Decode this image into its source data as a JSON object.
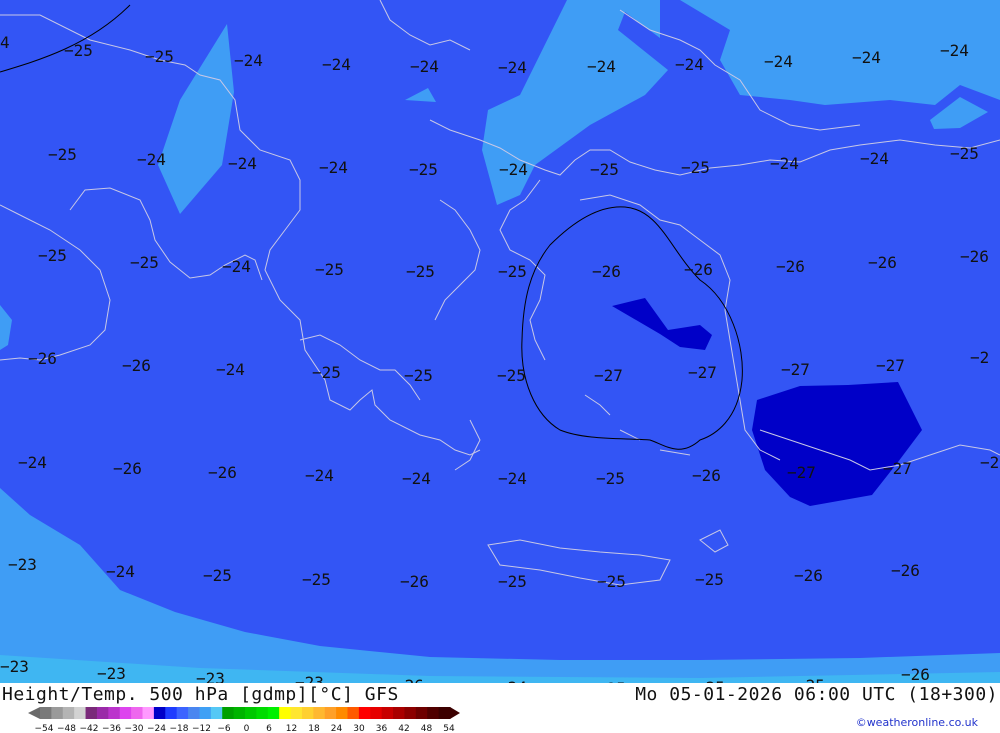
{
  "map": {
    "colors": {
      "deep_blue": "#0000c8",
      "mid_blue": "#3355f5",
      "light_blue": "#3f9df5",
      "coast_line": "#c8c8e6",
      "contour_line": "#000000"
    },
    "labels": [
      {
        "t": "4"
      },
      {
        "t": "-25"
      },
      {
        "t": "-25"
      },
      {
        "t": "-24"
      },
      {
        "t": "-24"
      },
      {
        "t": "-24"
      },
      {
        "t": "-24"
      },
      {
        "t": "-24"
      },
      {
        "t": "-24"
      },
      {
        "t": "-24"
      },
      {
        "t": "-24"
      },
      {
        "t": "-24"
      },
      {
        "t": "-25"
      },
      {
        "t": "-24"
      },
      {
        "t": "-24"
      },
      {
        "t": "-24"
      },
      {
        "t": "-25"
      },
      {
        "t": "-24"
      },
      {
        "t": "-25"
      },
      {
        "t": "-25"
      },
      {
        "t": "-24"
      },
      {
        "t": "-24"
      },
      {
        "t": "-25"
      },
      {
        "t": "-25"
      },
      {
        "t": "-25"
      },
      {
        "t": "-24"
      },
      {
        "t": "-25"
      },
      {
        "t": "-25"
      },
      {
        "t": "-25"
      },
      {
        "t": "-26"
      },
      {
        "t": "-26"
      },
      {
        "t": "-26"
      },
      {
        "t": "-26"
      },
      {
        "t": "-26"
      },
      {
        "t": "-26"
      },
      {
        "t": "-26"
      },
      {
        "t": "-24"
      },
      {
        "t": "-25"
      },
      {
        "t": "-25"
      },
      {
        "t": "-25"
      },
      {
        "t": "-27"
      },
      {
        "t": "-27"
      },
      {
        "t": "-27"
      },
      {
        "t": "-27"
      },
      {
        "t": "-2"
      },
      {
        "t": "-24"
      },
      {
        "t": "-26"
      },
      {
        "t": "-26"
      },
      {
        "t": "-24"
      },
      {
        "t": "-24"
      },
      {
        "t": "-24"
      },
      {
        "t": "-25"
      },
      {
        "t": "-26"
      },
      {
        "t": "-27"
      },
      {
        "t": "-27"
      },
      {
        "t": "-2"
      },
      {
        "t": "-23"
      },
      {
        "t": "-24"
      },
      {
        "t": "-25"
      },
      {
        "t": "-25"
      },
      {
        "t": "-26"
      },
      {
        "t": "-25"
      },
      {
        "t": "-25"
      },
      {
        "t": "-25"
      },
      {
        "t": "-26"
      },
      {
        "t": "-26"
      },
      {
        "t": "-23"
      },
      {
        "t": "-23"
      },
      {
        "t": "-23"
      },
      {
        "t": "-23"
      },
      {
        "t": "-26"
      },
      {
        "t": "-24"
      },
      {
        "t": "-25"
      },
      {
        "t": "-25"
      },
      {
        "t": "-25"
      },
      {
        "t": "-26"
      }
    ]
  },
  "footer": {
    "title": "Height/Temp. 500 hPa [gdmp][°C] GFS",
    "datetime": "Mo 05-01-2026 06:00 UTC (18+300)",
    "credit": "©weatheronline.co.uk"
  },
  "colorbar": {
    "ticks": [
      "-54",
      "-48",
      "-42",
      "-36",
      "-30",
      "-24",
      "-18",
      "-12",
      "-6",
      "0",
      "6",
      "12",
      "18",
      "24",
      "30",
      "36",
      "42",
      "48",
      "54"
    ],
    "swatches": [
      "#7a7a7a",
      "#9a9a9a",
      "#b4b4b4",
      "#d2d2d2",
      "#7a2a7a",
      "#9a2aa8",
      "#bb33cc",
      "#dd44ee",
      "#ee66ee",
      "#ff99ff",
      "#0000c8",
      "#1e3cff",
      "#3c64ff",
      "#4a86f0",
      "#3fa0f5",
      "#55c8f5",
      "#00a000",
      "#00b400",
      "#00c800",
      "#00dc00",
      "#00f000",
      "#ffff00",
      "#ffe630",
      "#ffd030",
      "#ffb830",
      "#ffa028",
      "#ff8a00",
      "#ff5a00",
      "#ff0000",
      "#e60000",
      "#c80000",
      "#aa0000",
      "#8c0000",
      "#6e0000",
      "#500000",
      "#3c0000"
    ]
  }
}
